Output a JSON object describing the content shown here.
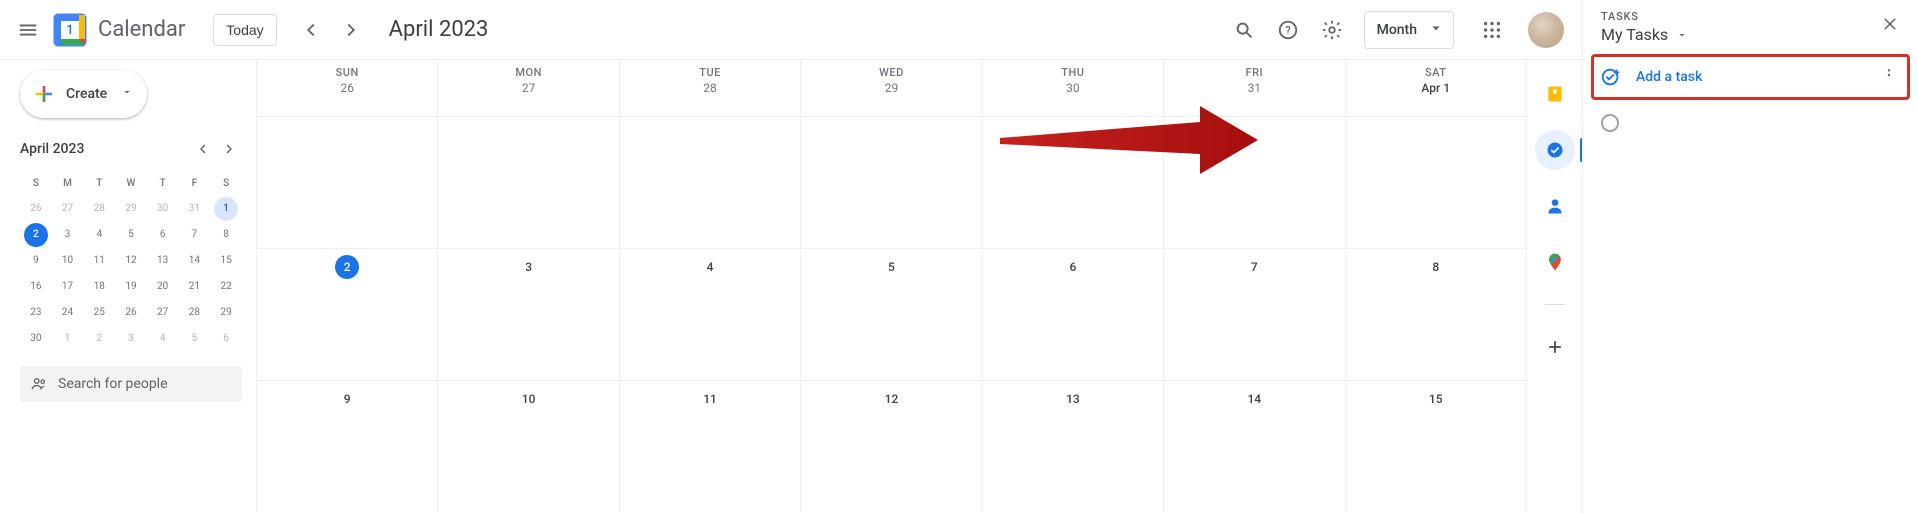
{
  "header": {
    "app_name": "Calendar",
    "today_label": "Today",
    "date_range": "April 2023",
    "view_label": "Month",
    "logo_day": "1"
  },
  "sidebar": {
    "create_label": "Create",
    "mini_title": "April 2023",
    "dow": [
      "S",
      "M",
      "T",
      "W",
      "T",
      "F",
      "S"
    ],
    "weeks": [
      [
        {
          "n": "26",
          "o": true
        },
        {
          "n": "27",
          "o": true
        },
        {
          "n": "28",
          "o": true
        },
        {
          "n": "29",
          "o": true
        },
        {
          "n": "30",
          "o": true
        },
        {
          "n": "31",
          "o": true
        },
        {
          "n": "1",
          "today_outline": true
        }
      ],
      [
        {
          "n": "2",
          "selected": true
        },
        {
          "n": "3"
        },
        {
          "n": "4"
        },
        {
          "n": "5"
        },
        {
          "n": "6"
        },
        {
          "n": "7"
        },
        {
          "n": "8"
        }
      ],
      [
        {
          "n": "9"
        },
        {
          "n": "10"
        },
        {
          "n": "11"
        },
        {
          "n": "12"
        },
        {
          "n": "13"
        },
        {
          "n": "14"
        },
        {
          "n": "15"
        }
      ],
      [
        {
          "n": "16"
        },
        {
          "n": "17"
        },
        {
          "n": "18"
        },
        {
          "n": "19"
        },
        {
          "n": "20"
        },
        {
          "n": "21"
        },
        {
          "n": "22"
        }
      ],
      [
        {
          "n": "23"
        },
        {
          "n": "24"
        },
        {
          "n": "25"
        },
        {
          "n": "26"
        },
        {
          "n": "27"
        },
        {
          "n": "28"
        },
        {
          "n": "29"
        }
      ],
      [
        {
          "n": "30"
        },
        {
          "n": "1",
          "o": true
        },
        {
          "n": "2",
          "o": true
        },
        {
          "n": "3",
          "o": true
        },
        {
          "n": "4",
          "o": true
        },
        {
          "n": "5",
          "o": true
        },
        {
          "n": "6",
          "o": true
        }
      ]
    ],
    "search_placeholder": "Search for people"
  },
  "grid": {
    "dow": [
      "SUN",
      "MON",
      "TUE",
      "WED",
      "THU",
      "FRI",
      "SAT"
    ],
    "row0_labels": [
      "26",
      "27",
      "28",
      "29",
      "30",
      "31",
      "Apr 1"
    ],
    "rows": [
      [
        {
          "n": "2",
          "today": true
        },
        {
          "n": "3"
        },
        {
          "n": "4"
        },
        {
          "n": "5"
        },
        {
          "n": "6"
        },
        {
          "n": "7"
        },
        {
          "n": "8"
        }
      ],
      [
        {
          "n": "9"
        },
        {
          "n": "10"
        },
        {
          "n": "11"
        },
        {
          "n": "12"
        },
        {
          "n": "13"
        },
        {
          "n": "14"
        },
        {
          "n": "15"
        }
      ]
    ]
  },
  "rail": {
    "items": [
      "keep",
      "tasks",
      "contacts",
      "maps"
    ],
    "active": "tasks"
  },
  "tasks": {
    "label": "TASKS",
    "list_name": "My Tasks",
    "add_label": "Add a task"
  }
}
